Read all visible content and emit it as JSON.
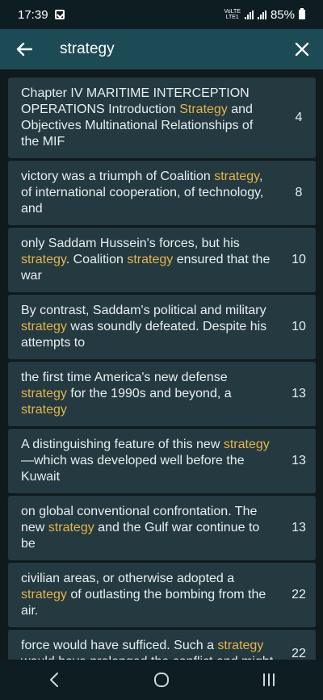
{
  "status_bar": {
    "time": "17:39",
    "network_top": "VoLTE",
    "network_bottom": "LTE1",
    "battery": "85%"
  },
  "app_bar": {
    "search_query": "strategy"
  },
  "results": [
    {
      "snippet": "Chapter IV MARITIME INTERCEPTION OPERATIONS Introduction [[Strategy]] and Objectives Multinational Relationships of the MIF",
      "page": "4"
    },
    {
      "snippet": "victory was a triumph of Coalition [[strategy]], of international cooperation, of technology, and",
      "page": "8"
    },
    {
      "snippet": "only Saddam Hussein's forces, but his [[strategy]]. Coalition [[strategy]] ensured that the war",
      "page": "10"
    },
    {
      "snippet": "By contrast, Saddam's political and military [[strategy]] was soundly defeated. Despite his attempts to",
      "page": "10"
    },
    {
      "snippet": "the first time America's new defense [[strategy]] for the 1990s and beyond, a [[strategy]]",
      "page": "13"
    },
    {
      "snippet": "A distinguishing feature of this new [[strategy]]—which was developed well before the Kuwait",
      "page": "13"
    },
    {
      "snippet": "on global conventional confrontation. The new [[strategy]] and the Gulf war continue to be",
      "page": "13"
    },
    {
      "snippet": "civilian areas, or otherwise adopted a [[strategy]] of outlasting the bombing from the air.",
      "page": "22"
    },
    {
      "snippet": "force would have sufficed. Such a [[strategy]] would have prolonged the conflict and might",
      "page": "22"
    }
  ],
  "colors": {
    "app_bar": "#1c4a55",
    "item_background": "#243a40",
    "highlight": "#e7b34a",
    "text": "#e8eef0"
  },
  "icons": {
    "back": "arrow-left-icon",
    "close": "close-icon",
    "nav_back": "chevron-left-icon",
    "nav_home": "home-circle-icon",
    "nav_recents": "recents-bars-icon"
  }
}
